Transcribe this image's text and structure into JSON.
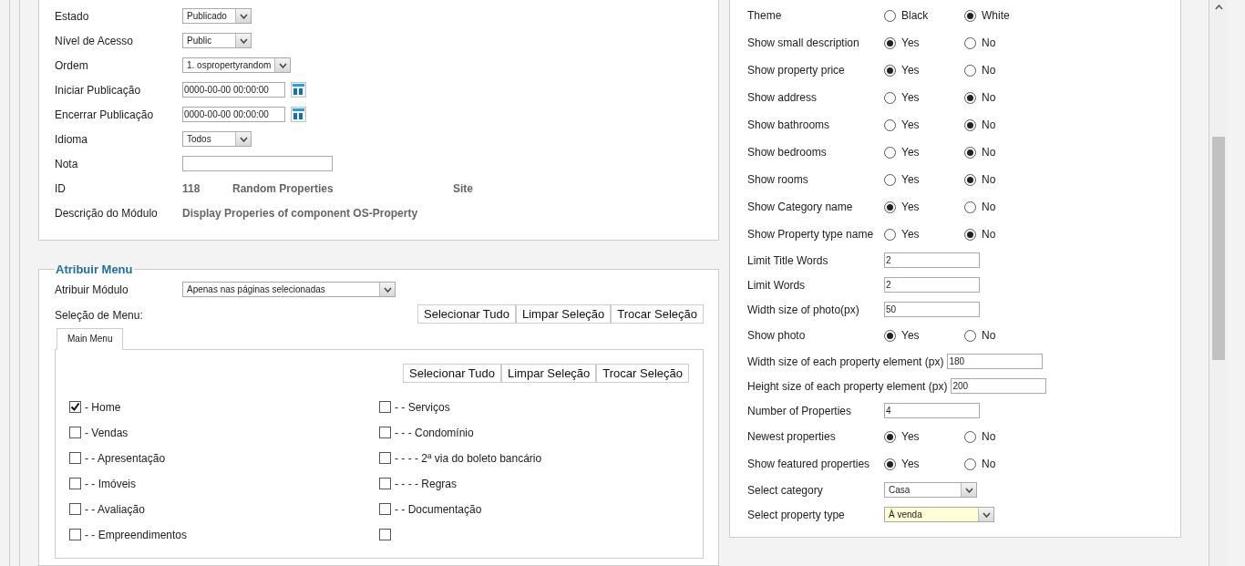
{
  "details": {
    "fields": [
      {
        "kind": "select",
        "label": "Estado",
        "value": "Publicado"
      },
      {
        "kind": "select",
        "label": "Nível de Acesso",
        "value": "Public"
      },
      {
        "kind": "select",
        "label": "Ordem",
        "value": "1. ospropertyrandom"
      },
      {
        "kind": "date",
        "label": "Iniciar Publicação",
        "value": "0000-00-00 00:00:00"
      },
      {
        "kind": "date",
        "label": "Encerrar Publicação",
        "value": "0000-00-00 00:00:00"
      },
      {
        "kind": "select",
        "label": "Idioma",
        "value": "Todos"
      },
      {
        "kind": "text",
        "label": "Nota"
      },
      {
        "kind": "info",
        "label": "ID",
        "values": [
          "118",
          "Random Properties",
          "Site"
        ]
      },
      {
        "kind": "info",
        "label": "Descrição do Módulo",
        "values": [
          "Display Properies of component OS-Property"
        ]
      }
    ]
  },
  "menu_assignment": {
    "legend": "Atribuir Menu",
    "assign_module": {
      "label": "Atribuir Módulo",
      "value": "Apenas nas páginas selecionadas"
    },
    "menu_selection_label": "Seleção de Menu:",
    "buttons": [
      "Selecionar Tudo",
      "Limpar Seleção",
      "Trocar Seleção"
    ],
    "tabs": [
      {
        "label": "Main Menu",
        "selected": true
      }
    ],
    "tab_buttons": [
      "Selecionar Tudo",
      "Limpar Seleção",
      "Trocar Seleção"
    ],
    "columns": [
      [
        {
          "label": "- Home",
          "checked": true
        },
        {
          "label": "- Vendas",
          "checked": false
        },
        {
          "label": "- - Apresentação",
          "checked": false
        },
        {
          "label": "- - Imóveis",
          "checked": false
        },
        {
          "label": "- - Avaliação",
          "checked": false
        },
        {
          "label": "- - Empreendimentos",
          "checked": false
        }
      ],
      [
        {
          "label": "- - Serviços",
          "checked": false
        },
        {
          "label": "- - - Condomínio",
          "checked": false
        },
        {
          "label": "- - - - 2ª via do boleto bancário",
          "checked": false
        },
        {
          "label": "- - - - Regras",
          "checked": false
        },
        {
          "label": "- - Documentação",
          "checked": false
        },
        {
          "checked": false
        }
      ]
    ]
  },
  "params": [
    {
      "kind": "radio",
      "label": "Theme",
      "options": [
        {
          "label": "Black",
          "selected": false
        },
        {
          "label": "White",
          "selected": true
        }
      ]
    },
    {
      "kind": "radio",
      "label": "Show small description",
      "options": [
        {
          "label": "Yes",
          "selected": true
        },
        {
          "label": "No",
          "selected": false
        }
      ]
    },
    {
      "kind": "radio",
      "label": "Show property price",
      "options": [
        {
          "label": "Yes",
          "selected": true
        },
        {
          "label": "No",
          "selected": false
        }
      ]
    },
    {
      "kind": "radio",
      "label": "Show address",
      "options": [
        {
          "label": "Yes",
          "selected": false
        },
        {
          "label": "No",
          "selected": true
        }
      ]
    },
    {
      "kind": "radio",
      "label": "Show bathrooms",
      "options": [
        {
          "label": "Yes",
          "selected": false
        },
        {
          "label": "No",
          "selected": true
        }
      ]
    },
    {
      "kind": "radio",
      "label": "Show bedrooms",
      "options": [
        {
          "label": "Yes",
          "selected": false
        },
        {
          "label": "No",
          "selected": true
        }
      ]
    },
    {
      "kind": "radio",
      "label": "Show rooms",
      "options": [
        {
          "label": "Yes",
          "selected": false
        },
        {
          "label": "No",
          "selected": true
        }
      ]
    },
    {
      "kind": "radio",
      "label": "Show Category name",
      "options": [
        {
          "label": "Yes",
          "selected": true
        },
        {
          "label": "No",
          "selected": false
        }
      ]
    },
    {
      "kind": "radio",
      "label": "Show Property type name",
      "options": [
        {
          "label": "Yes",
          "selected": false
        },
        {
          "label": "No",
          "selected": true
        }
      ]
    },
    {
      "kind": "text",
      "label": "Limit Title Words",
      "value": "2"
    },
    {
      "kind": "text",
      "label": "Limit Words",
      "value": "2"
    },
    {
      "kind": "text",
      "label": "Width size of photo(px)",
      "value": "50"
    },
    {
      "kind": "radio",
      "label": "Show photo",
      "options": [
        {
          "label": "Yes",
          "selected": true
        },
        {
          "label": "No",
          "selected": false
        }
      ]
    },
    {
      "kind": "text",
      "label": "Width size of each property element (px)",
      "value": "180"
    },
    {
      "kind": "text",
      "label": "Height size of each property element (px)",
      "value": "200"
    },
    {
      "kind": "text",
      "label": "Number of Properties",
      "value": "4"
    },
    {
      "kind": "radio",
      "label": "Newest properties",
      "options": [
        {
          "label": "Yes",
          "selected": true
        },
        {
          "label": "No",
          "selected": false
        }
      ]
    },
    {
      "kind": "radio",
      "label": "Show featured properties",
      "options": [
        {
          "label": "Yes",
          "selected": true
        },
        {
          "label": "No",
          "selected": false
        }
      ]
    },
    {
      "kind": "select",
      "label": "Select category",
      "value": "Casa",
      "focused": false
    },
    {
      "kind": "select",
      "label": "Select property type",
      "value": "À venda",
      "focused": true
    }
  ]
}
